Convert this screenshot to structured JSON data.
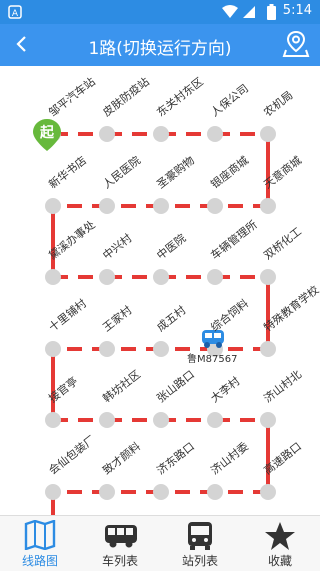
{
  "status": {
    "time": "5:14"
  },
  "header": {
    "title": "1路(切换运行方向)"
  },
  "start_badge": "起",
  "bus": {
    "plate": "鲁M87567"
  },
  "stops": [
    "邹平汽车站",
    "皮肤防疫站",
    "东关村东区",
    "人保公司",
    "农机局",
    "天意商城",
    "银座商城",
    "圣豪购物",
    "人民医院",
    "新华书店",
    "黛溪办事处",
    "中兴村",
    "中医院",
    "车辆管理所",
    "双桥化工",
    "特殊教育学校",
    "综合饲料",
    "成五村",
    "王家村",
    "十里铺村",
    "接官亭",
    "韩坊社区",
    "张山路口",
    "大李村",
    "济山村北",
    "高速路口",
    "济山村委",
    "济东路口",
    "致才颜料",
    "会仙包装厂"
  ],
  "tabs": [
    {
      "label": "线路图",
      "icon": "map-book-icon",
      "active": true
    },
    {
      "label": "车列表",
      "icon": "bus-side-icon",
      "active": false
    },
    {
      "label": "站列表",
      "icon": "bus-front-icon",
      "active": false
    },
    {
      "label": "收藏",
      "icon": "star-icon",
      "active": false
    }
  ],
  "colors": {
    "primary": "#3b94ee",
    "route_line": "#e53935",
    "stop_dot": "#d4d4d4",
    "bus_icon": "#2d8ce3",
    "start_badge": "#67b93c"
  }
}
